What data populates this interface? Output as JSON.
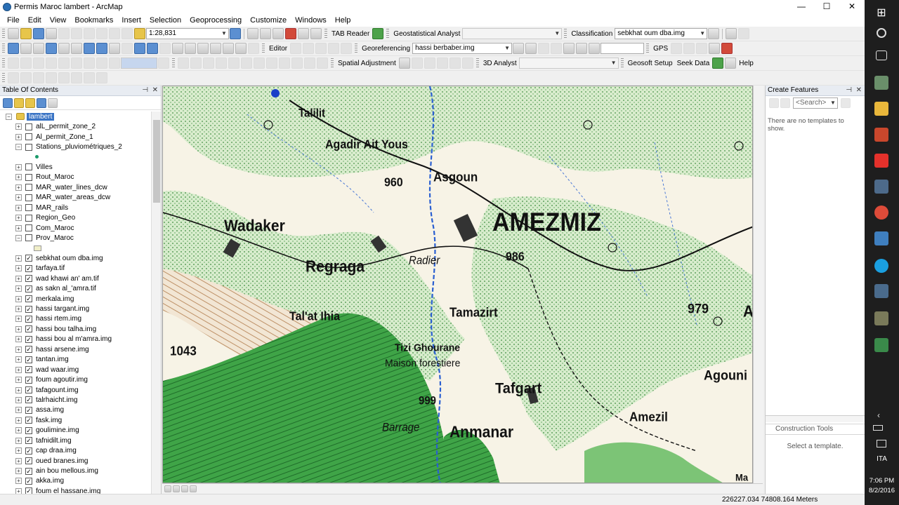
{
  "window": {
    "title": "Permis Maroc lambert - ArcMap",
    "minimize": "—",
    "maximize": "☐",
    "close": "✕"
  },
  "menu": [
    "File",
    "Edit",
    "View",
    "Bookmarks",
    "Insert",
    "Selection",
    "Geoprocessing",
    "Customize",
    "Windows",
    "Help"
  ],
  "toolbar": {
    "scale": "1:28,831",
    "tab_reader": "TAB Reader",
    "geostatistical": "Geostatistical Analyst",
    "classification": "Classification",
    "classification_layer": "sebkhat oum dba.img",
    "editor": "Editor",
    "georeferencing": "Georeferencing",
    "georef_layer": "hassi berbaber.img",
    "gps": "GPS",
    "spatial_adjustment": "Spatial Adjustment",
    "analyst_3d": "3D Analyst",
    "geosoft": "Geosoft Setup",
    "seek_data": "Seek Data",
    "help": "Help"
  },
  "toc": {
    "title": "Table Of Contents",
    "root": "lambert",
    "layers": [
      {
        "name": "alL_permit_zone_2",
        "checked": false
      },
      {
        "name": "Al_permit_Zone_1",
        "checked": false
      },
      {
        "name": "Stations_pluviométriques_2",
        "checked": false
      },
      {
        "name": "",
        "checked": false
      },
      {
        "name": "Villes",
        "checked": false
      },
      {
        "name": "Rout_Maroc",
        "checked": false
      },
      {
        "name": "MAR_water_lines_dcw",
        "checked": false
      },
      {
        "name": "MAR_water_areas_dcw",
        "checked": false
      },
      {
        "name": "MAR_rails",
        "checked": false
      },
      {
        "name": "Region_Geo",
        "checked": false
      },
      {
        "name": "Com_Maroc",
        "checked": false
      },
      {
        "name": "Prov_Maroc",
        "checked": false
      },
      {
        "name": "",
        "checked": false
      },
      {
        "name": "sebkhat oum dba.img",
        "checked": true
      },
      {
        "name": "tarfaya.tif",
        "checked": true
      },
      {
        "name": "wad khawi an' am.tif",
        "checked": true
      },
      {
        "name": "as sakn al_'amra.tif",
        "checked": true
      },
      {
        "name": "merkala.img",
        "checked": true
      },
      {
        "name": "hassi targant.img",
        "checked": true
      },
      {
        "name": "hassi rtem.img",
        "checked": true
      },
      {
        "name": "hassi bou talha.img",
        "checked": true
      },
      {
        "name": "hassi bou al m'amra.img",
        "checked": true
      },
      {
        "name": "hassi arsene.img",
        "checked": true
      },
      {
        "name": "tantan.img",
        "checked": true
      },
      {
        "name": "wad waar.img",
        "checked": true
      },
      {
        "name": "foum agoutir.img",
        "checked": true
      },
      {
        "name": "tafagount.img",
        "checked": true
      },
      {
        "name": "talrhaicht.img",
        "checked": true
      },
      {
        "name": "assa.img",
        "checked": true
      },
      {
        "name": "fask.img",
        "checked": true
      },
      {
        "name": "goulimine.img",
        "checked": true
      },
      {
        "name": "tafnidilt.img",
        "checked": true
      },
      {
        "name": "cap draa.img",
        "checked": true
      },
      {
        "name": "oued branes.img",
        "checked": true
      },
      {
        "name": "ain bou mellous.img",
        "checked": true
      },
      {
        "name": "akka.img",
        "checked": true
      },
      {
        "name": "foum el hassane.img",
        "checked": true
      }
    ]
  },
  "map_labels": {
    "talilit": "Talilit",
    "agadir": "Agadir Ait Yous",
    "asgoun": "Asgoun",
    "h960": "960",
    "amezmiz": "AMEZMIZ",
    "wadaker": "Wadaker",
    "regraga": "Regraga",
    "radier": "Radier",
    "h986": "986",
    "talat": "Tal'at Ihia",
    "tamazirt": "Tamazirt",
    "h979": "979",
    "a_edge": "A",
    "h1043": "1043",
    "tizi": "Tizi Ghourane",
    "maison": "Maison forestiere",
    "tafgart": "Tafgart",
    "agouni": "Agouni",
    "h999": "999",
    "barrage": "Barrage",
    "anmanar": "Anmanar",
    "amezil": "Amezil",
    "ma_edge": "Ma"
  },
  "create_features": {
    "title": "Create Features",
    "search_placeholder": "<Search>",
    "no_templates": "There are no templates to show.",
    "construction_title": "Construction Tools",
    "select_template": "Select a template."
  },
  "status": {
    "coords": "226227.034  74808.164 Meters"
  },
  "taskbar": {
    "lang": "ITA",
    "time": "7:06 PM",
    "date": "8/2/2016"
  }
}
